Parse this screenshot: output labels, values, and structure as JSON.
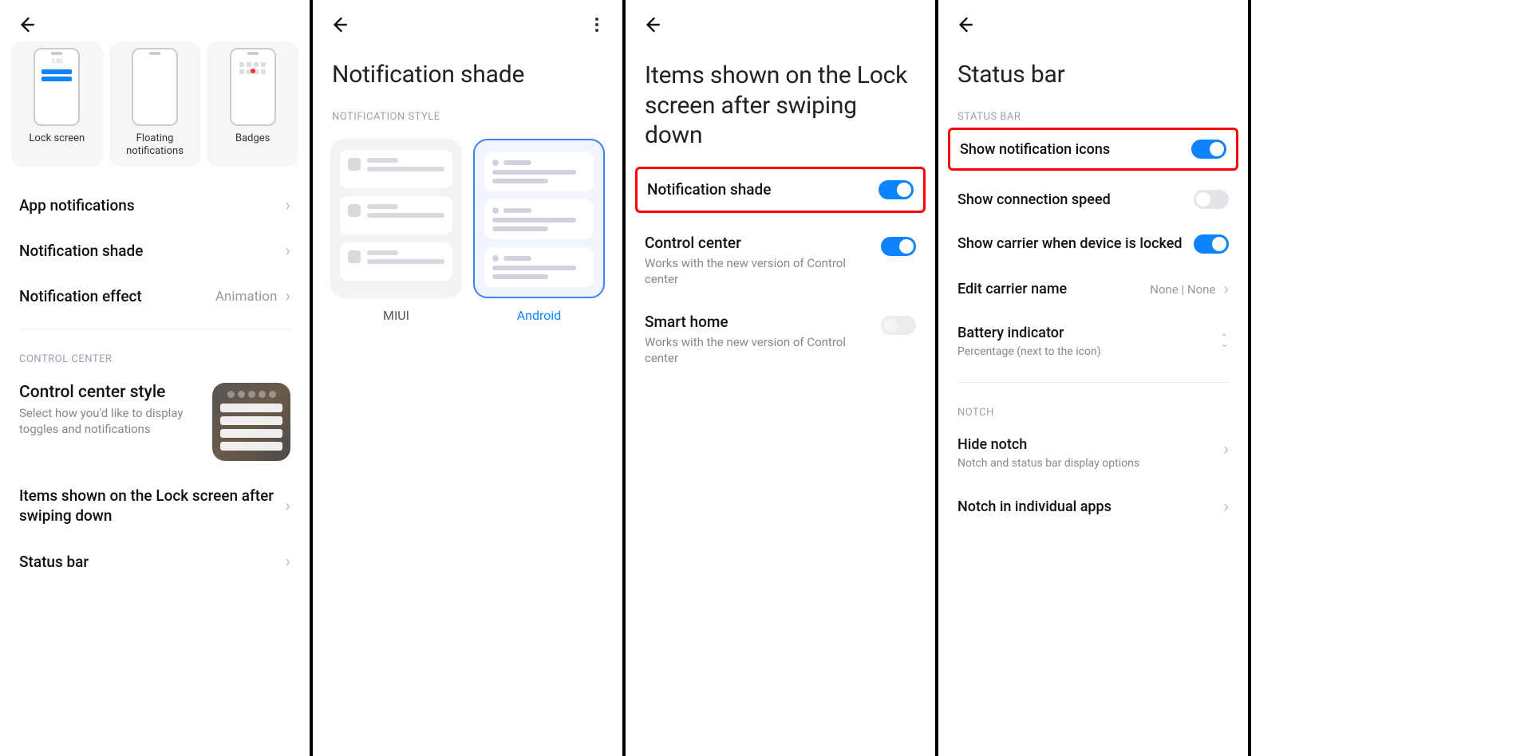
{
  "panel1": {
    "cards": [
      {
        "label": "Lock screen"
      },
      {
        "label": "Floating notifications"
      },
      {
        "label": "Badges"
      }
    ],
    "rows": {
      "app_notifications": "App notifications",
      "notification_shade": "Notification shade",
      "notification_effect": {
        "title": "Notification effect",
        "value": "Animation"
      }
    },
    "section_control": "CONTROL CENTER",
    "control_style": {
      "title": "Control center style",
      "sub": "Select how you'd like to display toggles and notifications"
    },
    "items_lock": "Items shown on the Lock screen after swiping down",
    "status_bar": "Status bar"
  },
  "panel2": {
    "title": "Notification shade",
    "section": "NOTIFICATION STYLE",
    "options": [
      {
        "label": "MIUI",
        "selected": false
      },
      {
        "label": "Android",
        "selected": true
      }
    ]
  },
  "panel3": {
    "title": "Items shown on the Lock screen after swiping down",
    "rows": [
      {
        "title": "Notification shade",
        "sub": "",
        "on": true,
        "highlight": true,
        "enabled": true
      },
      {
        "title": "Control center",
        "sub": "Works with the new version of Control center",
        "on": true,
        "highlight": false,
        "enabled": true
      },
      {
        "title": "Smart home",
        "sub": "Works with the new version of Control center",
        "on": false,
        "highlight": false,
        "enabled": false
      }
    ]
  },
  "panel4": {
    "title": "Status bar",
    "section1": "STATUS BAR",
    "rows1": [
      {
        "title": "Show notification icons",
        "type": "toggle",
        "on": true,
        "highlight": true
      },
      {
        "title": "Show connection speed",
        "type": "toggle",
        "on": false
      },
      {
        "title": "Show carrier when device is locked",
        "type": "toggle",
        "on": true
      },
      {
        "title": "Edit carrier name",
        "type": "value",
        "value": "None | None"
      },
      {
        "title": "Battery indicator",
        "type": "updown",
        "sub": "Percentage (next to the icon)"
      }
    ],
    "section2": "NOTCH",
    "rows2": [
      {
        "title": "Hide notch",
        "sub": "Notch and status bar display options",
        "type": "chevron"
      },
      {
        "title": "Notch in individual apps",
        "type": "chevron"
      }
    ]
  }
}
